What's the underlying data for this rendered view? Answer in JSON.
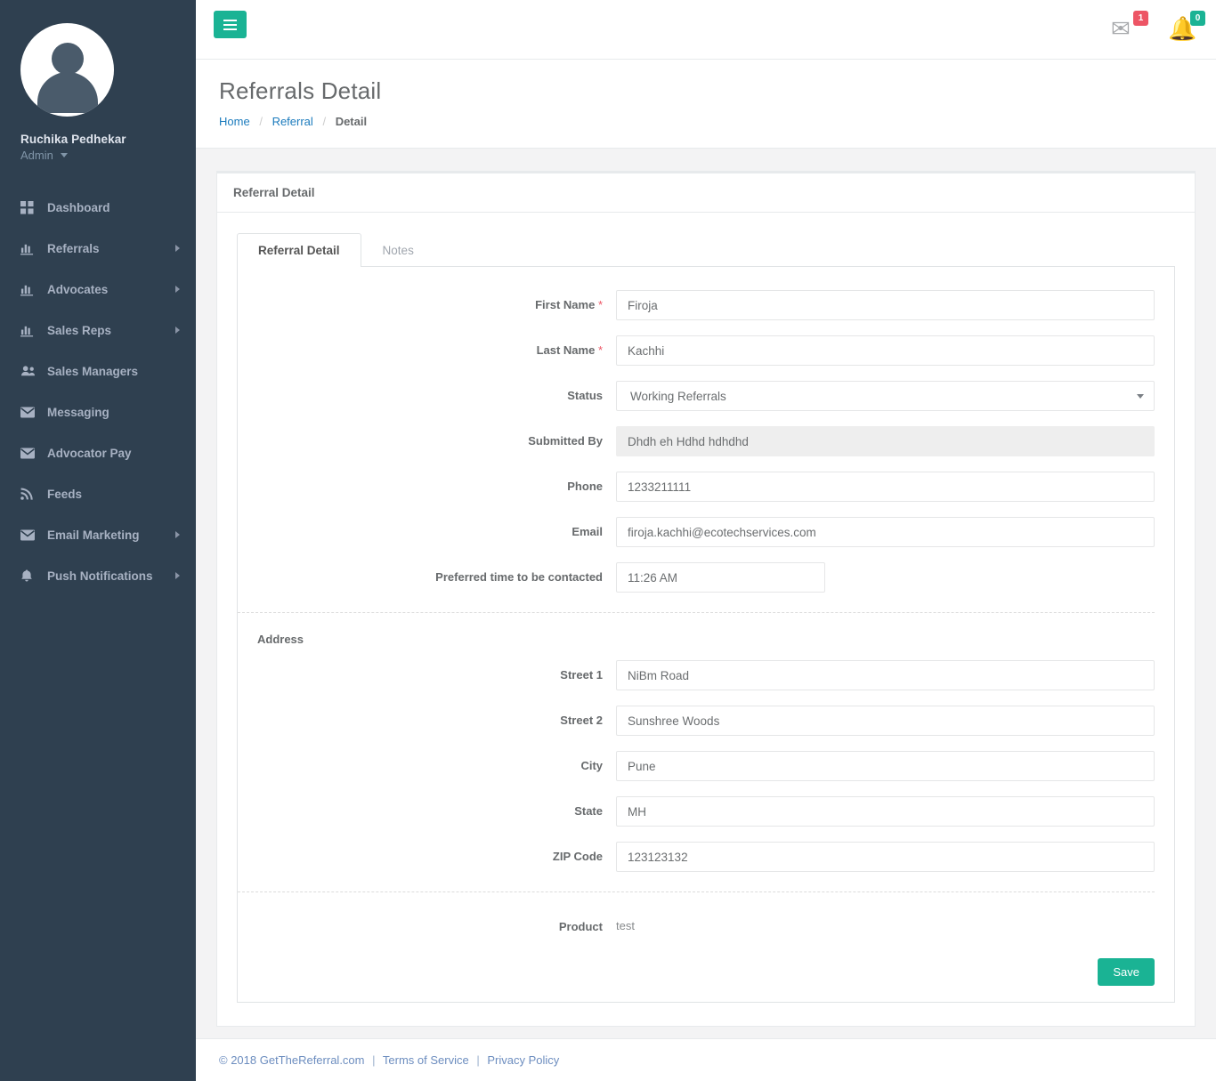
{
  "sidebar": {
    "profile": {
      "avatar_icon": "user-avatar-icon",
      "name": "Ruchika Pedhekar",
      "role": "Admin"
    },
    "items": [
      {
        "label": "Dashboard",
        "icon": "grid-icon",
        "has_chevron": false
      },
      {
        "label": "Referrals",
        "icon": "bar-chart-icon",
        "has_chevron": true
      },
      {
        "label": "Advocates",
        "icon": "bar-chart-icon",
        "has_chevron": true
      },
      {
        "label": "Sales Reps",
        "icon": "bar-chart-icon",
        "has_chevron": true
      },
      {
        "label": "Sales Managers",
        "icon": "users-icon",
        "has_chevron": false
      },
      {
        "label": "Messaging",
        "icon": "envelope-icon",
        "has_chevron": false
      },
      {
        "label": "Advocator Pay",
        "icon": "envelope-icon",
        "has_chevron": false
      },
      {
        "label": "Feeds",
        "icon": "rss-icon",
        "has_chevron": false
      },
      {
        "label": "Email Marketing",
        "icon": "envelope-icon",
        "has_chevron": true
      },
      {
        "label": "Push Notifications",
        "icon": "bell-icon",
        "has_chevron": true
      }
    ]
  },
  "topbar": {
    "menu_toggle_icon": "hamburger-icon",
    "messages": {
      "icon": "envelope-icon",
      "count": "1",
      "color": "#ed5565"
    },
    "notifications": {
      "icon": "bell-icon",
      "count": "0",
      "color": "#1ab394"
    }
  },
  "page": {
    "title": "Referrals Detail",
    "breadcrumb": {
      "home": "Home",
      "section": "Referral",
      "current": "Detail",
      "separator": "/"
    }
  },
  "panel": {
    "header": "Referral Detail",
    "tabs": [
      {
        "label": "Referral Detail",
        "active": true
      },
      {
        "label": "Notes",
        "active": false
      }
    ]
  },
  "form": {
    "first_name": {
      "label": "First Name",
      "required": true,
      "value": "Firoja"
    },
    "last_name": {
      "label": "Last Name",
      "required": true,
      "value": "Kachhi"
    },
    "status": {
      "label": "Status",
      "value": "Working Referrals",
      "caret_icon": "caret-down-icon"
    },
    "submitted_by": {
      "label": "Submitted By",
      "value": "Dhdh eh Hdhd hdhdhd",
      "disabled": true
    },
    "phone": {
      "label": "Phone",
      "value": "1233211111"
    },
    "email": {
      "label": "Email",
      "value": "firoja.kachhi@ecotechservices.com"
    },
    "preferred_time": {
      "label": "Preferred time to be contacted",
      "value": "11:26 AM"
    },
    "address_title": "Address",
    "street1": {
      "label": "Street 1",
      "value": "NiBm Road"
    },
    "street2": {
      "label": "Street 2",
      "value": "Sunshree Woods"
    },
    "city": {
      "label": "City",
      "value": "Pune"
    },
    "state": {
      "label": "State",
      "value": "MH"
    },
    "zip": {
      "label": "ZIP Code",
      "value": "123123132"
    },
    "product": {
      "label": "Product",
      "value": "test"
    },
    "save_label": "Save"
  },
  "footer": {
    "copyright": "© 2018 GetTheReferral.com",
    "terms": "Terms of Service",
    "privacy": "Privacy Policy",
    "separator": "|"
  },
  "colors": {
    "accent": "#1ab394",
    "sidebar": "#2f4050",
    "danger": "#ed5565",
    "link": "#6c8dbf"
  }
}
